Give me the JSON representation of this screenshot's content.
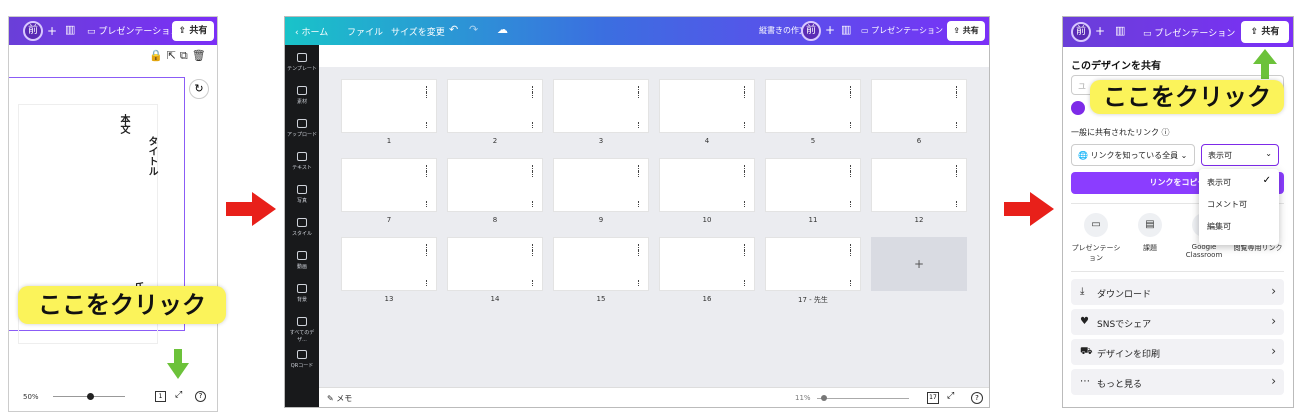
{
  "left_panel": {
    "avatar_letter": "前",
    "plus": "+",
    "present_label": "プレゼンテーション",
    "share_label": "共有",
    "text_body": "本文",
    "text_title": "タイトル",
    "text_name": "氏",
    "zoom": "50%",
    "page_count": "1",
    "help": "?"
  },
  "callout_label": "ここをクリック",
  "middle_panel": {
    "nav": {
      "home": "ホーム",
      "file": "ファイル",
      "resize": "サイズを変更"
    },
    "doc_title": "縦書きの作文",
    "avatar_letter": "前",
    "present_label": "プレゼンテーション",
    "share_label": "共有",
    "sidebar": [
      "テンプレート",
      "素材",
      "アップロード",
      "テキスト",
      "写真",
      "スタイル",
      "動画",
      "背景",
      "すべてのデザ...",
      "QRコード"
    ],
    "pages": [
      "1",
      "2",
      "3",
      "4",
      "5",
      "6",
      "7",
      "8",
      "9",
      "10",
      "11",
      "12",
      "13",
      "14",
      "15",
      "16",
      "17 - 先生"
    ],
    "add_page": "+",
    "memo": "メモ",
    "zoom": "11%",
    "page_count": "17",
    "help": "?"
  },
  "right_panel": {
    "avatar_letter": "前",
    "present_label": "プレゼンテーション",
    "share_label": "共有",
    "heading": "このデザインを共有",
    "input_char": "ユ",
    "general_link_label": "一般に共有されたリンク",
    "link_select": "リンクを知っている全員",
    "perm_select": "表示可",
    "perm_options": [
      "表示可",
      "コメント可",
      "編集可"
    ],
    "copy_link": "リンクをコピー",
    "share_items": [
      "プレゼンテーション",
      "課題",
      "Google Classroom",
      "閲覧専用リンク"
    ],
    "actions": [
      "ダウンロード",
      "SNSでシェア",
      "デザインを印刷",
      "もっと見る"
    ]
  },
  "colors": {
    "accent": "#7d2ae8",
    "callout": "#fbf35a",
    "arrow": "#e8201a",
    "green_arrow": "#6cc23a",
    "teal": "#19c3c9"
  }
}
